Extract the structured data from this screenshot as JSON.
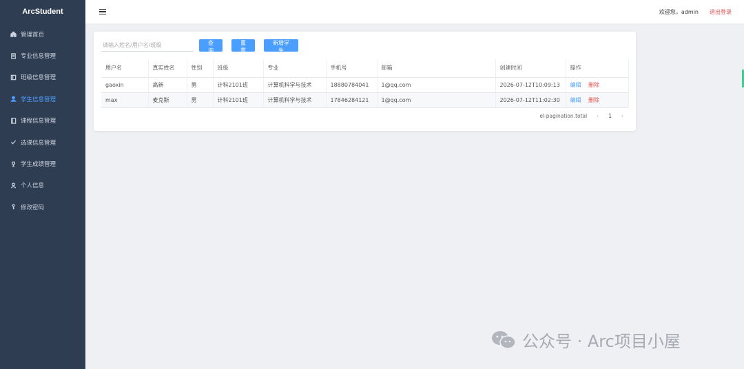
{
  "app": {
    "brand": "ArcStudent"
  },
  "sidebar": {
    "items": [
      {
        "label": "管理首页",
        "icon": "home-icon",
        "active": false
      },
      {
        "label": "专业信息管理",
        "icon": "document-icon",
        "active": false
      },
      {
        "label": "班级信息管理",
        "icon": "book-icon",
        "active": false
      },
      {
        "label": "学生信息管理",
        "icon": "user-icon",
        "active": true
      },
      {
        "label": "课程信息管理",
        "icon": "notebook-icon",
        "active": false
      },
      {
        "label": "选课信息管理",
        "icon": "check-icon",
        "active": false
      },
      {
        "label": "学生成绩管理",
        "icon": "trophy-icon",
        "active": false
      },
      {
        "label": "个人信息",
        "icon": "person-icon",
        "active": false
      },
      {
        "label": "修改密码",
        "icon": "key-icon",
        "active": false
      }
    ]
  },
  "header": {
    "welcome": "欢迎您，admin",
    "logout": "退出登录"
  },
  "toolbar": {
    "search_placeholder": "请输入姓名/用户名/班级",
    "search_label": "查询",
    "reset_label": "重置",
    "add_label": "新增学生"
  },
  "table": {
    "columns": [
      "用户名",
      "真实姓名",
      "性别",
      "班级",
      "专业",
      "手机号",
      "邮箱",
      "创建时间",
      "操作"
    ],
    "rows": [
      {
        "username": "gaoxin",
        "realname": "高新",
        "gender": "男",
        "class": "计科2101班",
        "major": "计算机科学与技术",
        "phone": "18880784041",
        "email": "1@qq.com",
        "created": "2026-07-12T10:09:13"
      },
      {
        "username": "max",
        "realname": "麦克斯",
        "gender": "男",
        "class": "计科2101班",
        "major": "计算机科学与技术",
        "phone": "17846284121",
        "email": "1@qq.com",
        "created": "2026-07-12T11:02:30"
      }
    ],
    "edit_label": "编辑",
    "delete_label": "删除"
  },
  "pagination": {
    "total_text": "el-pagination.total",
    "current_page": "1",
    "prev": "‹",
    "next": "›"
  },
  "watermark": {
    "text": "公众号 · Arc项目小屋"
  },
  "colors": {
    "sidebar": "#2f3d52",
    "accent": "#4a9eff",
    "danger": "#e05252"
  }
}
